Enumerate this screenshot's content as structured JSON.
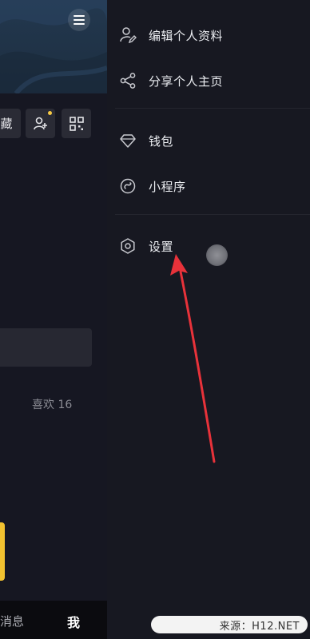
{
  "left_pane": {
    "collection_tile_text": "藏",
    "likes_text": "喜欢 16",
    "bottom_nav": {
      "messages_label": "消息",
      "me_label": "我"
    }
  },
  "drawer": {
    "items": [
      {
        "label": "编辑个人资料",
        "icon": "edit-profile-icon"
      },
      {
        "label": "分享个人主页",
        "icon": "share-icon"
      },
      {
        "label": "钱包",
        "icon": "wallet-diamond-icon"
      },
      {
        "label": "小程序",
        "icon": "mini-program-icon"
      },
      {
        "label": "设置",
        "icon": "settings-gear-icon"
      }
    ]
  },
  "watermark": {
    "text": "来源：H12.NET"
  },
  "colors": {
    "background": "#16171f",
    "drawer": "#171821",
    "accent_yellow": "#f2c230",
    "arrow_red": "#e8323a"
  }
}
